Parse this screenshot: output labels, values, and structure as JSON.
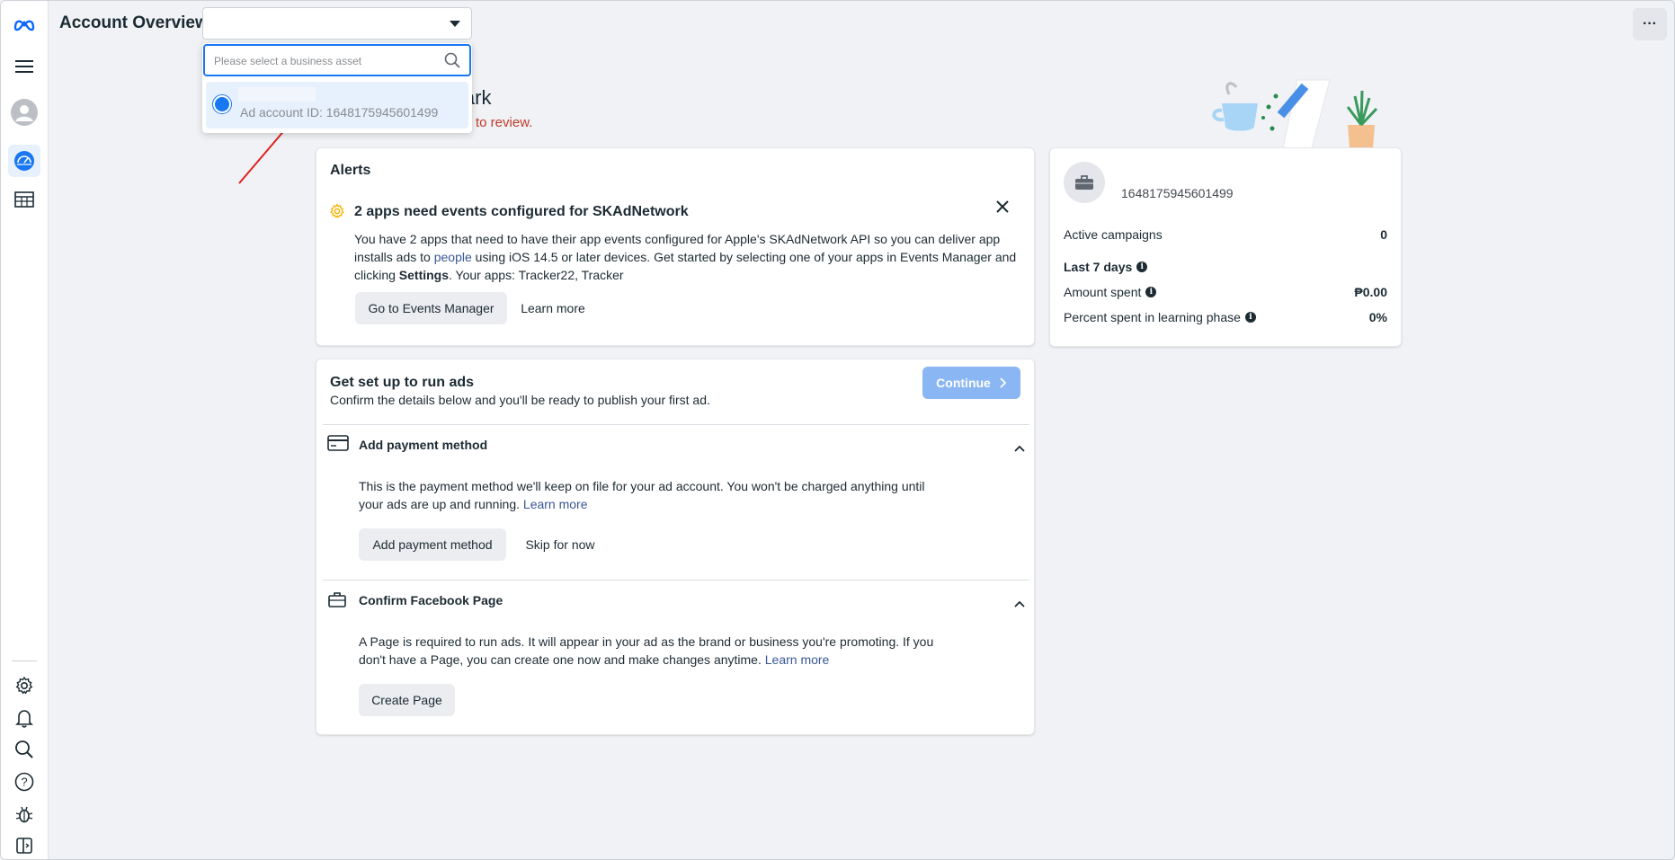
{
  "header": {
    "page_title": "Account Overview",
    "account_select_value": "",
    "more_label": "···"
  },
  "dropdown": {
    "search_placeholder": "Please select a business asset",
    "option_account_id": "Ad account ID: 1648175945601499"
  },
  "greeting": {
    "name_tail": "lark",
    "review_link": "to review."
  },
  "alerts": {
    "title": "Alerts",
    "alert_title": "2 apps need events configured for SKAdNetwork",
    "body_part1": "You have 2 apps that need to have their app events configured for Apple's SKAdNetwork API so you can deliver app installs ads to ",
    "body_link": "people",
    "body_part2": " using iOS 14.5 or later devices. Get started by selecting one of your apps in Events Manager and clicking ",
    "body_bold": "Settings",
    "body_part3": ". Your apps: Tracker22, Tracker",
    "go_events_label": "Go to Events Manager",
    "learn_more_label": "Learn more"
  },
  "setup": {
    "title": "Get set up to run ads",
    "subtitle": "Confirm the details below and you'll be ready to publish your first ad.",
    "continue_label": "Continue",
    "payment": {
      "title": "Add payment method",
      "body": "This is the payment method we'll keep on file for your ad account. You won't be charged anything until your ads are up and running.",
      "learn_more": "Learn more",
      "add_label": "Add payment method",
      "skip_label": "Skip for now"
    },
    "page": {
      "title": "Confirm Facebook Page",
      "body": "A Page is required to run ads. It will appear in your ad as the brand or business you're promoting. If you don't have a Page, you can create one now and make changes anytime.",
      "learn_more": "Learn more",
      "create_label": "Create Page"
    }
  },
  "account_summary": {
    "account_id": "1648175945601499",
    "active_campaigns_label": "Active campaigns",
    "active_campaigns_value": "0",
    "last7_label": "Last 7 days",
    "amount_spent_label": "Amount spent",
    "amount_spent_value": "₱0.00",
    "learning_label": "Percent spent in learning phase",
    "learning_value": "0%"
  },
  "colors": {
    "accent": "#1877f2",
    "continue_disabled": "#8ab6f4",
    "annotation_arrow": "#e02020"
  },
  "icons": {
    "rail": [
      "meta-logo-icon",
      "menu-icon",
      "avatar-icon",
      "dashboard-icon",
      "table-icon",
      "settings-icon",
      "bell-icon",
      "search-icon",
      "help-icon",
      "bug-icon",
      "sidebar-toggle-icon"
    ]
  }
}
